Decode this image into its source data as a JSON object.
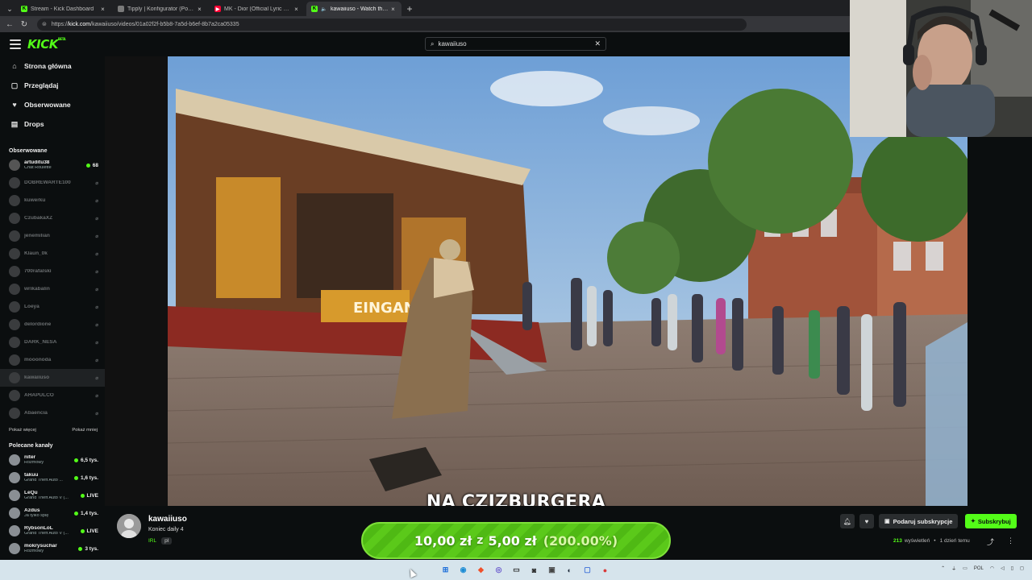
{
  "browser": {
    "tabs": [
      {
        "title": "Stream - Kick Dashboard",
        "icon": "kick-icon",
        "color": "#53fc18",
        "active": false
      },
      {
        "title": "Tipply | Konfigurator (Powiadomie",
        "icon": "tipply-icon",
        "color": "#7a7a7a",
        "active": false
      },
      {
        "title": "MK - Dior (Official Lyric Video) ft.",
        "icon": "youtube-icon",
        "color": "#ff0033",
        "active": false
      },
      {
        "title": "kawaiiuso - Watch the VOD o",
        "icon": "kick-icon",
        "color": "#53fc18",
        "active": true
      }
    ],
    "url_prefix": "https://",
    "url_host": "kick.com",
    "url_path": "/kawaiiuso/videos/01a02f2f-b5b8-7a5d-b6ef-8b7a2ca05335"
  },
  "header": {
    "logo": "KICK",
    "logo_tag": "BETA",
    "search_value": "kawaiiuso"
  },
  "sidebar": {
    "nav": [
      {
        "label": "Strona główna",
        "icon": "home-icon",
        "glyph": "⌂"
      },
      {
        "label": "Przeglądaj",
        "icon": "browse-icon",
        "glyph": "▢"
      },
      {
        "label": "Obserwowane",
        "icon": "heart-icon",
        "glyph": "♥"
      },
      {
        "label": "Drops",
        "icon": "drops-icon",
        "glyph": "▤"
      }
    ],
    "followed_header": "Obserwowane",
    "followed": [
      {
        "name": "artuditu38",
        "sub": "Chat Roulette",
        "viewers": "68",
        "live": true
      },
      {
        "name": "DOBREWARTE100",
        "sub": "",
        "viewers": "⌀",
        "live": false
      },
      {
        "name": "kuwerku",
        "sub": "",
        "viewers": "⌀",
        "live": false
      },
      {
        "name": "CzubakaXZ",
        "sub": "",
        "viewers": "⌀",
        "live": false
      },
      {
        "name": "jenemilian",
        "sub": "",
        "viewers": "⌀",
        "live": false
      },
      {
        "name": "Klaun_0k",
        "sub": "",
        "viewers": "⌀",
        "live": false
      },
      {
        "name": "700rafalski",
        "sub": "",
        "viewers": "⌀",
        "live": false
      },
      {
        "name": "wrikabalin",
        "sub": "",
        "viewers": "⌀",
        "live": false
      },
      {
        "name": "Loeya",
        "sub": "",
        "viewers": "⌀",
        "live": false
      },
      {
        "name": "delordione",
        "sub": "",
        "viewers": "⌀",
        "live": false
      },
      {
        "name": "DARK_NESA",
        "sub": "",
        "viewers": "⌀",
        "live": false
      },
      {
        "name": "mooonoda",
        "sub": "",
        "viewers": "⌀",
        "live": false
      },
      {
        "name": "kawaiiuso",
        "sub": "",
        "viewers": "⌀",
        "live": false
      },
      {
        "name": "AHAPULCO",
        "sub": "",
        "viewers": "⌀",
        "live": false
      },
      {
        "name": "Abaencia",
        "sub": "",
        "viewers": "⌀",
        "live": false
      }
    ],
    "show_more": "Pokaż więcej",
    "show_less": "Pokaż mniej",
    "recommended_header": "Polecane kanały",
    "recommended": [
      {
        "name": "niter",
        "sub": "Rozmowy",
        "viewers": "6,5 tys."
      },
      {
        "name": "takuu",
        "sub": "Grand Theft Auto ...",
        "viewers": "1,6 tys."
      },
      {
        "name": "LeQu",
        "sub": "Grand Theft Auto V (...",
        "viewers": "LIVE"
      },
      {
        "name": "Azdus",
        "sub": "Ja tylko śpię",
        "viewers": "1,4 tys."
      },
      {
        "name": "RybsonLoL",
        "sub": "Grand Theft Auto V (...",
        "viewers": "LIVE"
      },
      {
        "name": "mokrysuchar",
        "sub": "Rozmowy",
        "viewers": "3 tys."
      }
    ]
  },
  "video": {
    "caption": "NA CZIZBURGERA",
    "sign_text": "EINGAN"
  },
  "info": {
    "streamer": "kawaiiuso",
    "title": "Koniec daily 4",
    "category": "IRL",
    "language": "pl",
    "gift_label": "Podaruj subskrypcje",
    "subscribe_label": "Subskrybuj",
    "views_count": "213",
    "views_label": "wyświetleń",
    "time_ago": "1 dzień temu"
  },
  "goal": {
    "current": "10,00 zł",
    "of": "z",
    "target": "5,00 zł",
    "percent": "(200.00%)"
  },
  "taskbar": {
    "lang": "POL"
  },
  "colors": {
    "accent": "#53fc18",
    "background": "#0b0e0f",
    "taskbar": "#d6e4ec"
  }
}
